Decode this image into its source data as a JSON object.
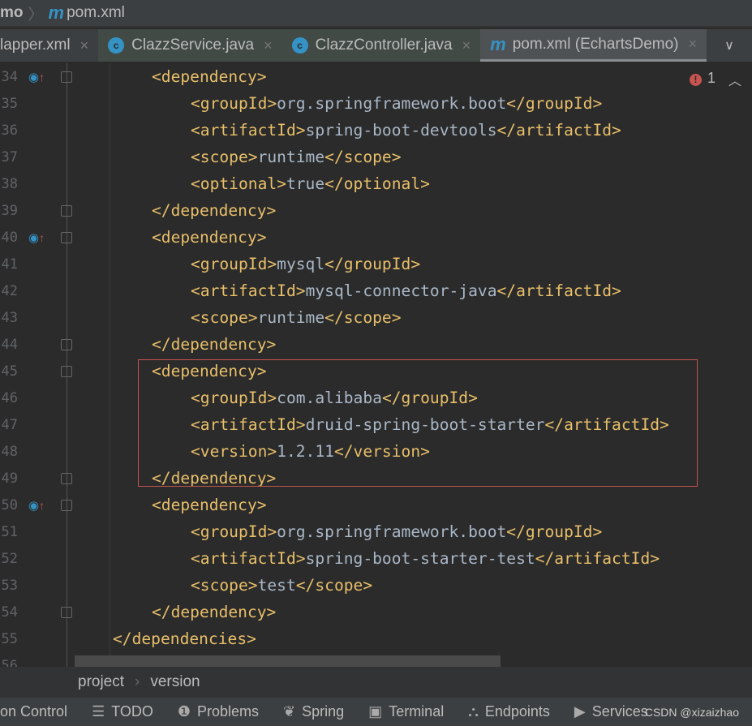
{
  "nav": {
    "project": "mo",
    "file": "pom.xml",
    "icon": "maven-m-icon"
  },
  "tabs": [
    {
      "label": "lapper.xml",
      "icon": ""
    },
    {
      "label": "ClazzService.java",
      "icon": "class-icon",
      "glyph": "c"
    },
    {
      "label": "ClazzController.java",
      "icon": "class-icon",
      "glyph": "c"
    },
    {
      "label": "pom.xml (EchartsDemo)",
      "icon": "maven-m-icon",
      "active": true
    }
  ],
  "close_glyph": "×",
  "error_count": "1",
  "error_glyph": "!",
  "lines": [
    {
      "n": "34",
      "i": 1,
      "t": "<dependency>",
      "mark": true
    },
    {
      "n": "35",
      "i": 2,
      "o": "<groupId>",
      "v": "org.springframework.boot",
      "c": "</groupId>"
    },
    {
      "n": "36",
      "i": 2,
      "o": "<artifactId>",
      "v": "spring-boot-devtools",
      "c": "</artifactId>"
    },
    {
      "n": "37",
      "i": 2,
      "o": "<scope>",
      "v": "runtime",
      "c": "</scope>"
    },
    {
      "n": "38",
      "i": 2,
      "o": "<optional>",
      "v": "true",
      "c": "</optional>"
    },
    {
      "n": "39",
      "i": 1,
      "t": "</dependency>"
    },
    {
      "n": "40",
      "i": 1,
      "t": "<dependency>",
      "mark": true
    },
    {
      "n": "41",
      "i": 2,
      "o": "<groupId>",
      "v": "mysql",
      "c": "</groupId>"
    },
    {
      "n": "42",
      "i": 2,
      "o": "<artifactId>",
      "v": "mysql-connector-java",
      "c": "</artifactId>"
    },
    {
      "n": "43",
      "i": 2,
      "o": "<scope>",
      "v": "runtime",
      "c": "</scope>"
    },
    {
      "n": "44",
      "i": 1,
      "t": "</dependency>"
    },
    {
      "n": "45",
      "i": 1,
      "t": "<dependency>"
    },
    {
      "n": "46",
      "i": 2,
      "o": "<groupId>",
      "v": "com.alibaba",
      "c": "</groupId>"
    },
    {
      "n": "47",
      "i": 2,
      "o": "<artifactId>",
      "v": "druid-spring-boot-starter",
      "c": "</artifactId>"
    },
    {
      "n": "48",
      "i": 2,
      "o": "<version>",
      "v": "1.2.11",
      "c": "</version>"
    },
    {
      "n": "49",
      "i": 1,
      "t": "</dependency>"
    },
    {
      "n": "50",
      "i": 1,
      "t": "<dependency>",
      "mark": true
    },
    {
      "n": "51",
      "i": 2,
      "o": "<groupId>",
      "v": "org.springframework.boot",
      "c": "</groupId>"
    },
    {
      "n": "52",
      "i": 2,
      "o": "<artifactId>",
      "v": "spring-boot-starter-test",
      "c": "</artifactId>"
    },
    {
      "n": "53",
      "i": 2,
      "o": "<scope>",
      "v": "test",
      "c": "</scope>"
    },
    {
      "n": "54",
      "i": 1,
      "t": "</dependency>"
    },
    {
      "n": "55",
      "i": 0,
      "t": "</dependencies>"
    },
    {
      "n": "56",
      "i": 0,
      "t": ""
    }
  ],
  "breadcrumb": [
    "project",
    "version"
  ],
  "toolwindows": [
    {
      "label": "on Control",
      "glyph": ""
    },
    {
      "label": "TODO",
      "glyph": "☰",
      "icon": "list-icon"
    },
    {
      "label": "Problems",
      "glyph": "❶",
      "icon": "problems-icon"
    },
    {
      "label": "Spring",
      "glyph": "❦",
      "icon": "spring-leaf-icon"
    },
    {
      "label": "Terminal",
      "glyph": "▣",
      "icon": "terminal-icon"
    },
    {
      "label": "Endpoints",
      "glyph": "⛬",
      "icon": "endpoints-icon"
    },
    {
      "label": "Services",
      "glyph": "▶",
      "icon": "services-icon"
    }
  ],
  "watermark": "CSDN @xizaizhao",
  "colors": {
    "tag": "#e8bf6a",
    "text": "#a9b7c6",
    "bg": "#2b2b2b",
    "highlight_border": "#c75450",
    "accent": "#3592c4"
  }
}
